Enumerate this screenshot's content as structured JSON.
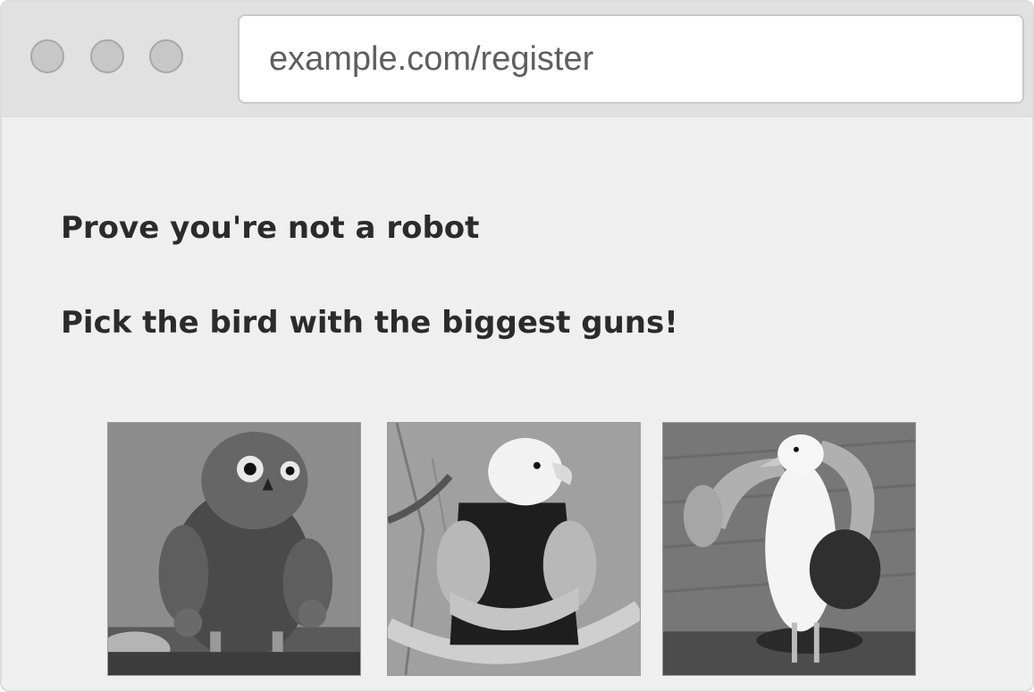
{
  "browser": {
    "url": "example.com/register"
  },
  "captcha": {
    "title": "Prove you're not a robot",
    "instruction": "Pick the bird with the biggest guns!",
    "options": [
      {
        "icon": "muscular-owl-image"
      },
      {
        "icon": "muscular-eagle-image"
      },
      {
        "icon": "muscular-seagull-image"
      }
    ]
  }
}
